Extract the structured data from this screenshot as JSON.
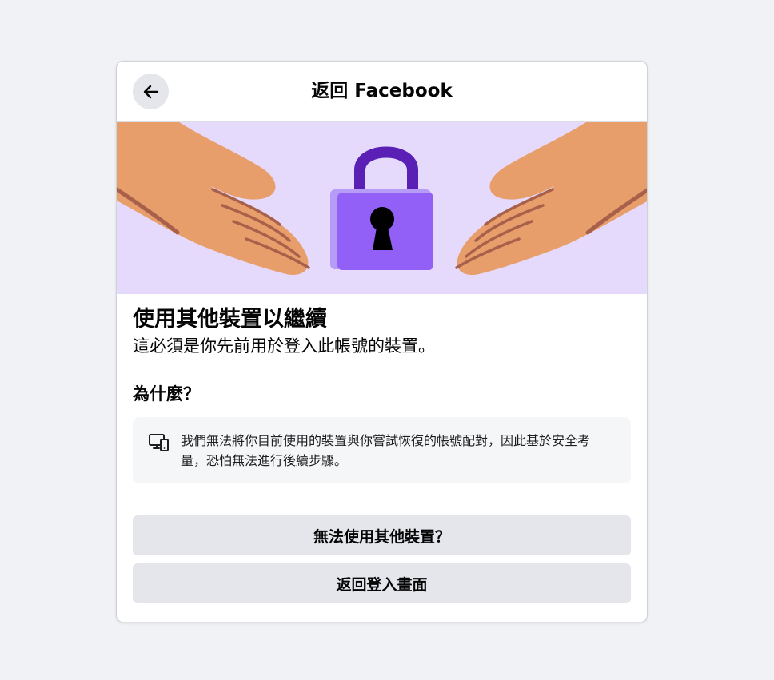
{
  "header": {
    "title": "返回 Facebook",
    "back_icon": "arrow-left-icon"
  },
  "banner": {
    "illustration": "hands-with-padlock",
    "icons": [
      "left-hand-icon",
      "padlock-icon",
      "right-hand-icon"
    ],
    "colors": {
      "background": "#e5dafc",
      "skin": "#e89e6b",
      "skin_line": "#a8604b",
      "lock_body": "#9360f7",
      "lock_shackle": "#5a1fb4"
    }
  },
  "main": {
    "heading": "使用其他裝置以繼續",
    "subheading": "這必須是你先前用於登入此帳號的裝置。",
    "why_title": "為什麼？",
    "info_icon": "devices-icon",
    "info_text": "我們無法將你目前使用的裝置與你嘗試恢復的帳號配對，因此基於安全考量，恐怕無法進行後續步驟。"
  },
  "buttons": {
    "other_device": "無法使用其他裝置？",
    "back_to_login": "返回登入畫面"
  }
}
